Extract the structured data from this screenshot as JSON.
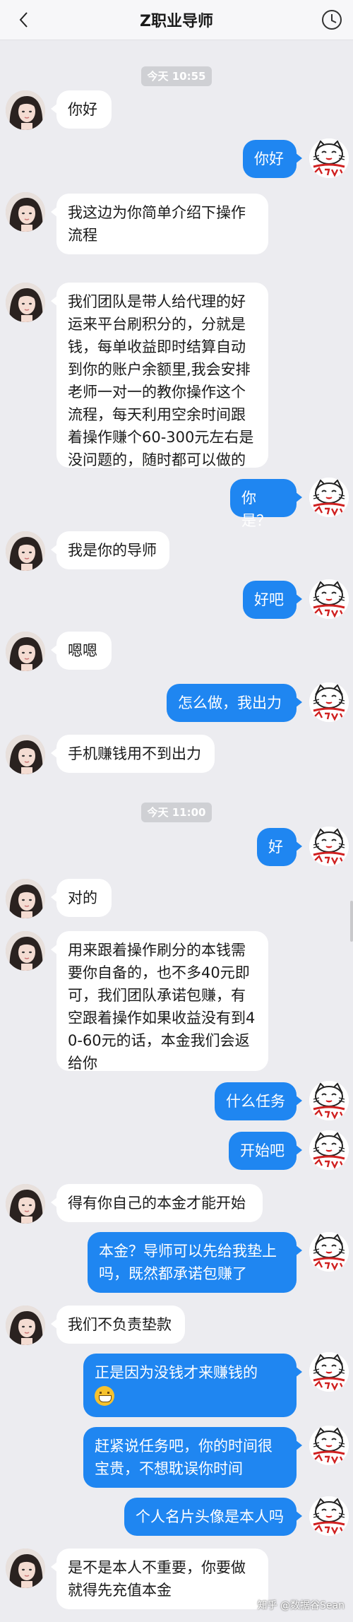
{
  "header": {
    "title": "Z职业导师",
    "back_icon": "chevron-left-icon",
    "history_icon": "clock-icon"
  },
  "colors": {
    "outgoing_bubble": "#1f86f1",
    "incoming_bubble": "#ffffff",
    "background": "#ececf0"
  },
  "timestamps": [
    "今天 10:55",
    "今天 11:00"
  ],
  "messages": [
    {
      "text": "你好"
    },
    {
      "text": "你好"
    },
    {
      "text": "我这边为你简单介绍下操作流程"
    },
    {
      "text": "我们团队是带人给代理的好运来平台刷积分的，分就是钱，每单收益即时结算自动到你的账户余额里,我会安排老师一对一的教你操作这个流程，每天利用空余时间跟着操作赚个60-300元左右是没问题的，随时都可以做的"
    },
    {
      "text": "你是？"
    },
    {
      "text": "我是你的导师"
    },
    {
      "text": "好吧"
    },
    {
      "text": "嗯嗯"
    },
    {
      "text": "怎么做，我出力"
    },
    {
      "text": "手机赚钱用不到出力"
    },
    {
      "text": "好"
    },
    {
      "text": "对的"
    },
    {
      "text": "用来跟着操作刷分的本钱需要你自备的，也不多40元即可，我们团队承诺包赚，有空跟着操作如果收益没有到40-60元的话，本金我们会返给你"
    },
    {
      "text": "什么任务"
    },
    {
      "text": "开始吧"
    },
    {
      "text": "得有你自己的本金才能开始"
    },
    {
      "text": "本金？导师可以先给我垫上吗，既然都承诺包赚了"
    },
    {
      "text": "我们不负责垫款"
    },
    {
      "text": "正是因为没钱才来赚钱的"
    },
    {
      "text": "赶紧说任务吧，你的时间很宝贵，不想耽误你时间"
    },
    {
      "text": "个人名片头像是本人吗"
    },
    {
      "text": "是不是本人不重要，你要做就得先充值本金"
    }
  ],
  "watermark": "知乎 @数据谷Sean"
}
